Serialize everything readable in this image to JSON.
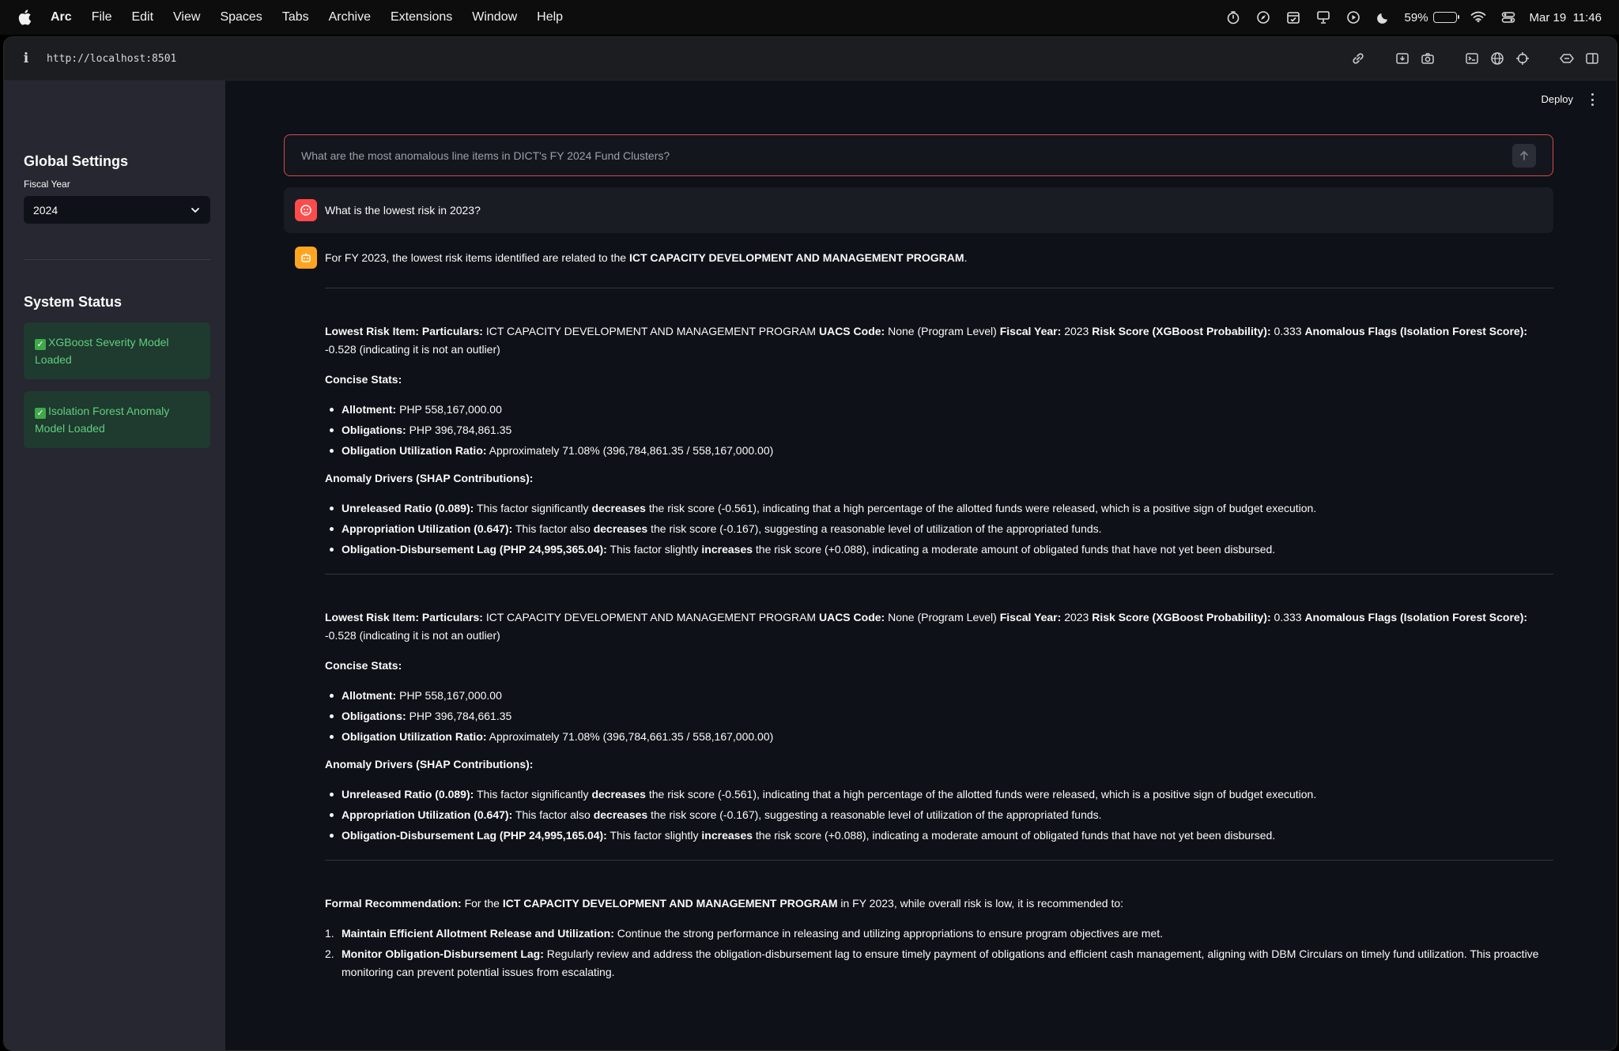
{
  "menubar": {
    "app_name": "Arc",
    "items": [
      "File",
      "Edit",
      "View",
      "Spaces",
      "Tabs",
      "Archive",
      "Extensions",
      "Window",
      "Help"
    ],
    "battery_percent": "59%",
    "battery_level": 0.59,
    "datetime": "Mar 19  11:46"
  },
  "browser": {
    "url": "http://localhost:8501"
  },
  "sidebar": {
    "global_settings_title": "Global Settings",
    "fiscal_year_label": "Fiscal Year",
    "fiscal_year_value": "2024",
    "system_status_title": "System Status",
    "status_1": "XGBoost Severity Model Loaded",
    "status_2": "Isolation Forest Anomaly Model Loaded"
  },
  "header": {
    "deploy_label": "Deploy"
  },
  "chat": {
    "input_placeholder": "What are the most anomalous line items in DICT's FY 2024 Fund Clusters?",
    "user_message": "What is the lowest risk in 2023?",
    "intro": {
      "pre": "For FY 2023, the lowest risk items identified are related to the ",
      "bold": "ICT CAPACITY DEVELOPMENT AND MANAGEMENT PROGRAM",
      "post": "."
    },
    "blocks": [
      {
        "particulars_label": "Lowest Risk Item: Particulars:",
        "particulars": "ICT CAPACITY DEVELOPMENT AND MANAGEMENT PROGRAM",
        "uacs_label": "UACS Code:",
        "uacs": "None (Program Level)",
        "fy_label": "Fiscal Year:",
        "fy": "2023",
        "risk_label": "Risk Score (XGBoost Probability):",
        "risk": "0.333",
        "anom_label": "Anomalous Flags (Isolation Forest Score):",
        "anom": "-0.528 (indicating it is not an outlier)",
        "stats_title": "Concise Stats:",
        "allotment_label": "Allotment:",
        "allotment": "PHP 558,167,000.00",
        "obligations_label": "Obligations:",
        "obligations": "PHP 396,784,861.35",
        "ratio_label": "Obligation Utilization Ratio:",
        "ratio": "Approximately 71.08% (396,784,861.35 / 558,167,000.00)",
        "drivers_title": "Anomaly Drivers (SHAP Contributions):",
        "d1_label": "Unreleased Ratio (0.089):",
        "d1_pre": "This factor significantly ",
        "d1_verb": "decreases",
        "d1_post": " the risk score (-0.561), indicating that a high percentage of the allotted funds were released, which is a positive sign of budget execution.",
        "d2_label": "Appropriation Utilization (0.647):",
        "d2_pre": "This factor also ",
        "d2_verb": "decreases",
        "d2_post": " the risk score (-0.167), suggesting a reasonable level of utilization of the appropriated funds.",
        "d3_label": "Obligation-Disbursement Lag (PHP 24,995,365.04):",
        "d3_pre": "This factor slightly ",
        "d3_verb": "increases",
        "d3_post": " the risk score (+0.088), indicating a moderate amount of obligated funds that have not yet been disbursed."
      },
      {
        "particulars_label": "Lowest Risk Item: Particulars:",
        "particulars": "ICT CAPACITY DEVELOPMENT AND MANAGEMENT PROGRAM",
        "uacs_label": "UACS Code:",
        "uacs": "None (Program Level)",
        "fy_label": "Fiscal Year:",
        "fy": "2023",
        "risk_label": "Risk Score (XGBoost Probability):",
        "risk": "0.333",
        "anom_label": "Anomalous Flags (Isolation Forest Score):",
        "anom": "-0.528 (indicating it is not an outlier)",
        "stats_title": "Concise Stats:",
        "allotment_label": "Allotment:",
        "allotment": "PHP 558,167,000.00",
        "obligations_label": "Obligations:",
        "obligations": "PHP 396,784,661.35",
        "ratio_label": "Obligation Utilization Ratio:",
        "ratio": "Approximately 71.08% (396,784,661.35 / 558,167,000.00)",
        "drivers_title": "Anomaly Drivers (SHAP Contributions):",
        "d1_label": "Unreleased Ratio (0.089):",
        "d1_pre": "This factor significantly ",
        "d1_verb": "decreases",
        "d1_post": " the risk score (-0.561), indicating that a high percentage of the allotted funds were released, which is a positive sign of budget execution.",
        "d2_label": "Appropriation Utilization (0.647):",
        "d2_pre": "This factor also ",
        "d2_verb": "decreases",
        "d2_post": " the risk score (-0.167), suggesting a reasonable level of utilization of the appropriated funds.",
        "d3_label": "Obligation-Disbursement Lag (PHP 24,995,165.04):",
        "d3_pre": "This factor slightly ",
        "d3_verb": "increases",
        "d3_post": " the risk score (+0.088), indicating a moderate amount of obligated funds that have not yet been disbursed."
      }
    ],
    "recommendation": {
      "label": "Formal Recommendation:",
      "pre": " For the ",
      "program": "ICT CAPACITY DEVELOPMENT AND MANAGEMENT PROGRAM",
      "post": " in FY 2023, while overall risk is low, it is recommended to:",
      "items": [
        {
          "num": "1.",
          "label": "Maintain Efficient Allotment Release and Utilization:",
          "text": " Continue the strong performance in releasing and utilizing appropriations to ensure program objectives are met."
        },
        {
          "num": "2.",
          "label": "Monitor Obligation-Disbursement Lag:",
          "text": " Regularly review and address the obligation-disbursement lag to ensure timely payment of obligations and efficient cash management, aligning with DBM Circulars on timely fund utilization. This proactive monitoring can prevent potential issues from escalating."
        }
      ]
    }
  }
}
